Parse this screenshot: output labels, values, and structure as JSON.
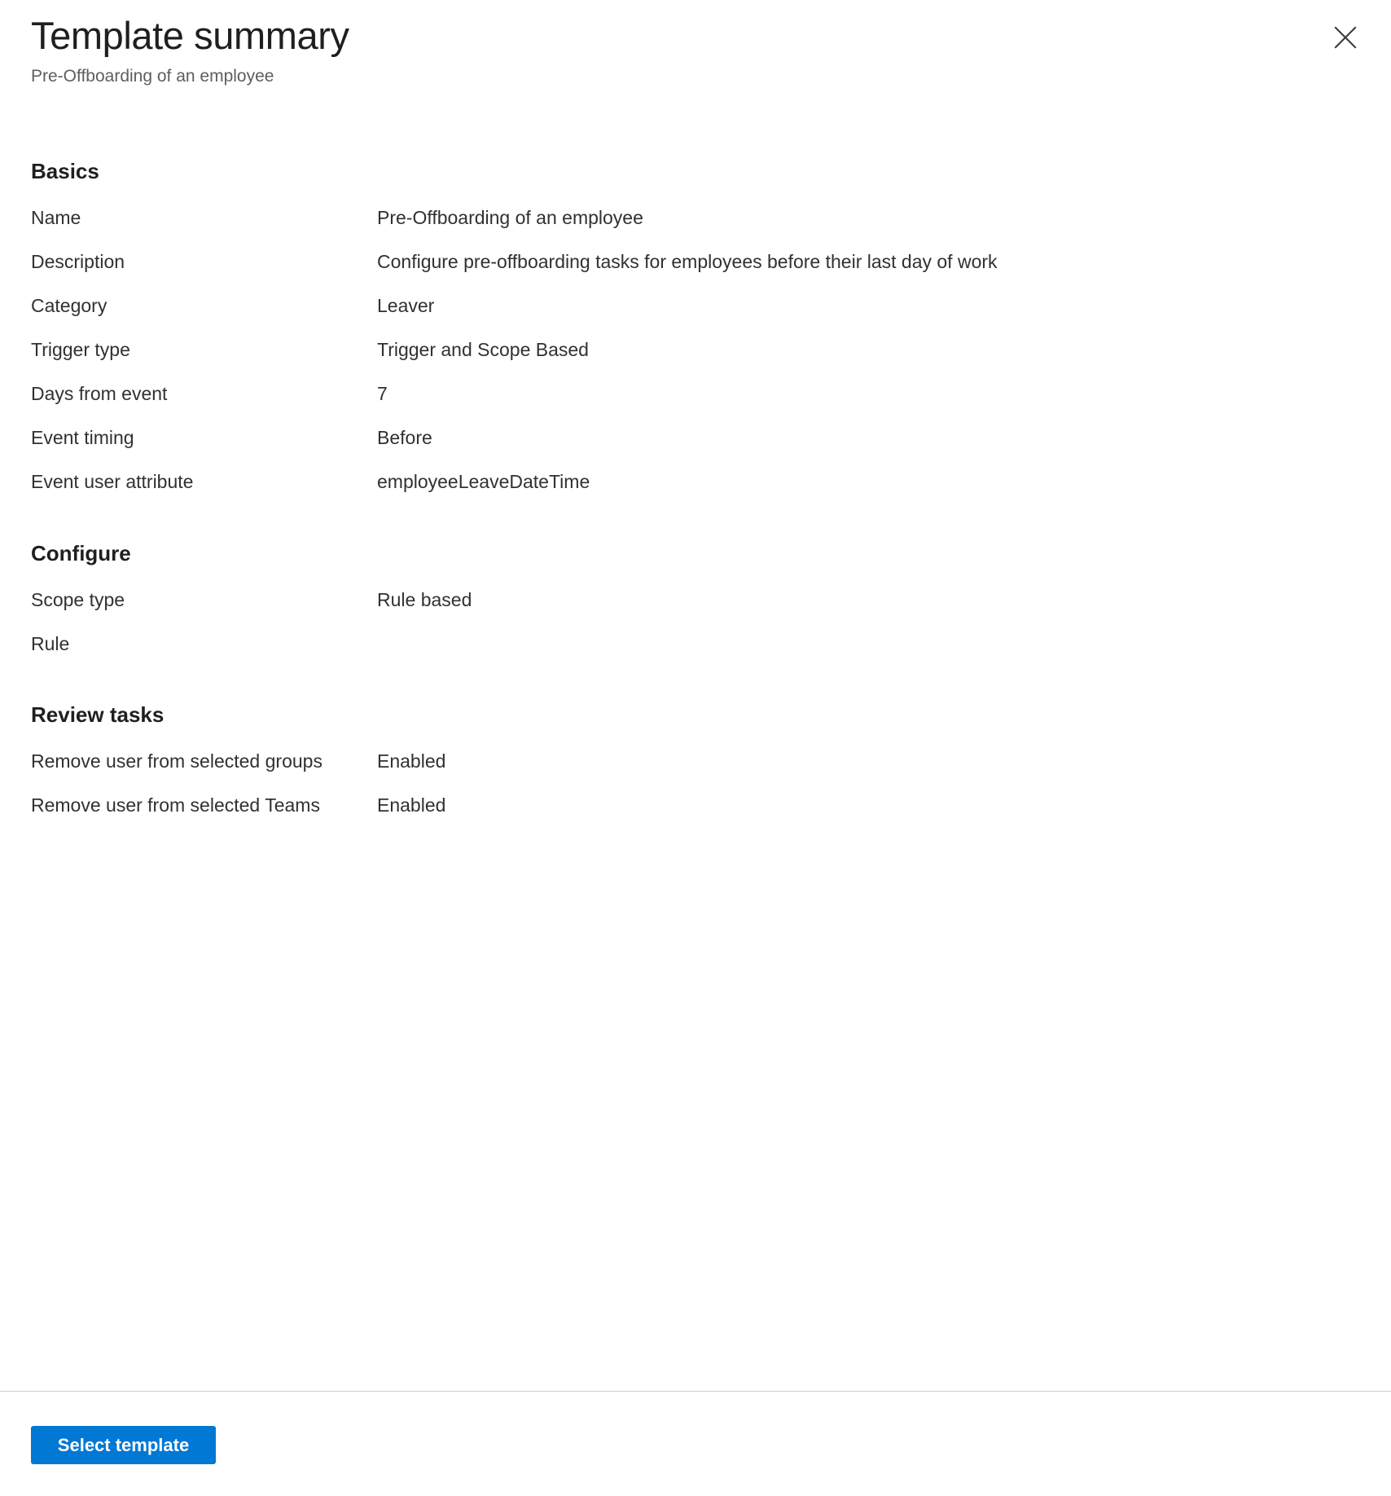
{
  "header": {
    "title": "Template summary",
    "subtitle": "Pre-Offboarding of an employee",
    "close_label": "Close"
  },
  "sections": [
    {
      "heading": "Basics",
      "rows": [
        {
          "label": "Name",
          "value": "Pre-Offboarding of an employee"
        },
        {
          "label": "Description",
          "value": "Configure pre-offboarding tasks for employees before their last day of work"
        },
        {
          "label": "Category",
          "value": "Leaver"
        },
        {
          "label": "Trigger type",
          "value": "Trigger and Scope Based"
        },
        {
          "label": "Days from event",
          "value": "7"
        },
        {
          "label": "Event timing",
          "value": "Before"
        },
        {
          "label": "Event user attribute",
          "value": "employeeLeaveDateTime"
        }
      ]
    },
    {
      "heading": "Configure",
      "rows": [
        {
          "label": "Scope type",
          "value": "Rule based"
        },
        {
          "label": "Rule",
          "value": ""
        }
      ]
    },
    {
      "heading": "Review tasks",
      "rows": [
        {
          "label": "Remove user from selected groups",
          "value": "Enabled"
        },
        {
          "label": "Remove user from selected Teams",
          "value": "Enabled"
        }
      ]
    }
  ],
  "footer": {
    "select_template_label": "Select template"
  },
  "colors": {
    "primary": "#0078d4",
    "title_text": "#201f1e",
    "body_text": "#323130",
    "subtitle_text": "#605e5c",
    "divider": "#d2d0ce"
  }
}
